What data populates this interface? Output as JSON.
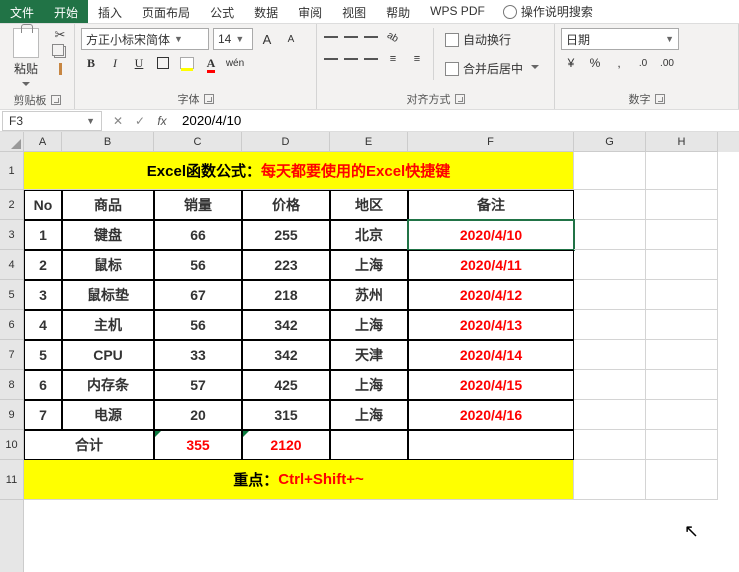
{
  "tabs": {
    "file": "文件",
    "home": "开始",
    "insert": "插入",
    "layout": "页面布局",
    "formulas": "公式",
    "data": "数据",
    "review": "审阅",
    "view": "视图",
    "help": "帮助",
    "wps": "WPS PDF",
    "tell": "操作说明搜索"
  },
  "ribbon": {
    "clipboard": {
      "label": "剪贴板",
      "paste": "粘贴"
    },
    "font": {
      "label": "字体",
      "name": "方正小标宋简体",
      "size": "14",
      "incA": "A",
      "decA": "A",
      "bold": "B",
      "italic": "I",
      "underline": "U",
      "wen": "wén"
    },
    "align": {
      "label": "对齐方式",
      "wrap": "自动换行",
      "merge": "合并后居中"
    },
    "number": {
      "label": "数字",
      "format": "日期"
    }
  },
  "formula_bar": {
    "cell_ref": "F3",
    "fx": "fx",
    "value": "2020/4/10"
  },
  "cols": [
    "A",
    "B",
    "C",
    "D",
    "E",
    "F",
    "G",
    "H"
  ],
  "rows": [
    "1",
    "2",
    "3",
    "4",
    "5",
    "6",
    "7",
    "8",
    "9",
    "10",
    "11"
  ],
  "title": {
    "part1": "Excel函数公式：",
    "part2": "每天都要使用的Excel快捷键"
  },
  "headers": {
    "no": "No",
    "product": "商品",
    "sales": "销量",
    "price": "价格",
    "region": "地区",
    "note": "备注"
  },
  "data_rows": [
    {
      "no": "1",
      "product": "键盘",
      "sales": "66",
      "price": "255",
      "region": "北京",
      "note": "2020/4/10"
    },
    {
      "no": "2",
      "product": "鼠标",
      "sales": "56",
      "price": "223",
      "region": "上海",
      "note": "2020/4/11"
    },
    {
      "no": "3",
      "product": "鼠标垫",
      "sales": "67",
      "price": "218",
      "region": "苏州",
      "note": "2020/4/12"
    },
    {
      "no": "4",
      "product": "主机",
      "sales": "56",
      "price": "342",
      "region": "上海",
      "note": "2020/4/13"
    },
    {
      "no": "5",
      "product": "CPU",
      "sales": "33",
      "price": "342",
      "region": "天津",
      "note": "2020/4/14"
    },
    {
      "no": "6",
      "product": "内存条",
      "sales": "57",
      "price": "425",
      "region": "上海",
      "note": "2020/4/15"
    },
    {
      "no": "7",
      "product": "电源",
      "sales": "20",
      "price": "315",
      "region": "上海",
      "note": "2020/4/16"
    }
  ],
  "totals": {
    "label": "合计",
    "sales": "355",
    "price": "2120"
  },
  "footer": {
    "part1": "重点：",
    "part2": "Ctrl+Shift+~"
  },
  "chart_data": {
    "type": "table",
    "title": "Excel函数公式：每天都要使用的Excel快捷键",
    "columns": [
      "No",
      "商品",
      "销量",
      "价格",
      "地区",
      "备注"
    ],
    "rows": [
      [
        1,
        "键盘",
        66,
        255,
        "北京",
        "2020/4/10"
      ],
      [
        2,
        "鼠标",
        56,
        223,
        "上海",
        "2020/4/11"
      ],
      [
        3,
        "鼠标垫",
        67,
        218,
        "苏州",
        "2020/4/12"
      ],
      [
        4,
        "主机",
        56,
        342,
        "上海",
        "2020/4/13"
      ],
      [
        5,
        "CPU",
        33,
        342,
        "天津",
        "2020/4/14"
      ],
      [
        6,
        "内存条",
        57,
        425,
        "上海",
        "2020/4/15"
      ],
      [
        7,
        "电源",
        20,
        315,
        "上海",
        "2020/4/16"
      ]
    ],
    "totals": {
      "销量": 355,
      "价格": 2120
    },
    "footer": "重点：Ctrl+Shift+~"
  }
}
